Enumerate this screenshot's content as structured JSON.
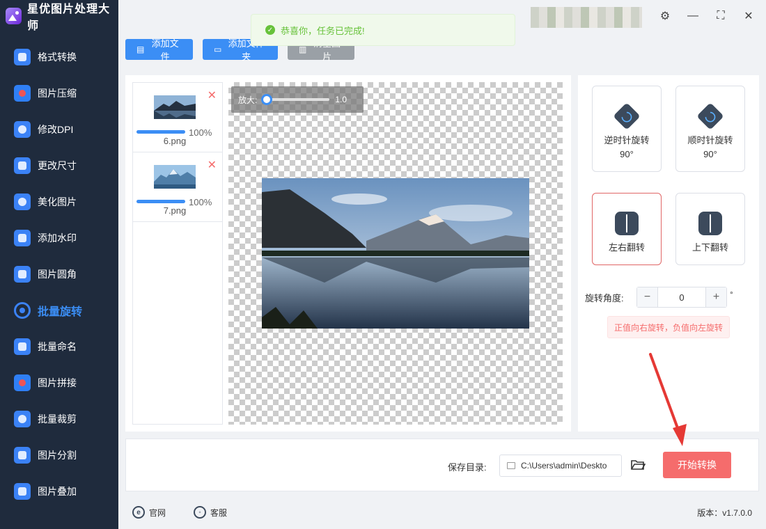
{
  "app": {
    "title": "星优图片处理大师"
  },
  "sidebar": {
    "items": [
      {
        "label": "格式转换",
        "icon": "image-convert-icon"
      },
      {
        "label": "图片压缩",
        "icon": "image-compress-icon"
      },
      {
        "label": "修改DPI",
        "icon": "dpi-icon"
      },
      {
        "label": "更改尺寸",
        "icon": "resize-icon"
      },
      {
        "label": "美化图片",
        "icon": "beautify-icon"
      },
      {
        "label": "添加水印",
        "icon": "watermark-icon"
      },
      {
        "label": "图片圆角",
        "icon": "rounded-corner-icon"
      },
      {
        "label": "批量旋转",
        "icon": "rotate-icon",
        "active": true
      },
      {
        "label": "批量命名",
        "icon": "rename-icon"
      },
      {
        "label": "图片拼接",
        "icon": "splice-icon"
      },
      {
        "label": "批量裁剪",
        "icon": "crop-icon"
      },
      {
        "label": "图片分割",
        "icon": "split-icon"
      },
      {
        "label": "图片叠加",
        "icon": "overlay-icon"
      }
    ]
  },
  "toolbar": {
    "add_file": "添加文件",
    "add_folder": "添加文件夹",
    "clear": "清空图片"
  },
  "toast": {
    "message": "恭喜你，任务已完成!"
  },
  "files": [
    {
      "name": "6.png",
      "progress": "100%",
      "progress_value": 1.0
    },
    {
      "name": "7.png",
      "progress": "100%",
      "progress_value": 1.0
    }
  ],
  "zoom": {
    "label": "放大:",
    "value": "1.0"
  },
  "rotate": {
    "ccw": "逆时针旋转90°",
    "cw": "顺时针旋转90°",
    "flip_h": "左右翻转",
    "flip_v": "上下翻转",
    "angle_label": "旋转角度:",
    "angle_value": "0",
    "degree_symbol": "°",
    "hint": "正值向右旋转，负值向左旋转"
  },
  "bottom": {
    "save_label": "保存目录:",
    "save_path": "C:\\Users\\admin\\Deskto",
    "start": "开始转换"
  },
  "footer": {
    "website": "官网",
    "service": "客服",
    "version": "版本：v1.7.0.0"
  },
  "colors": {
    "accent": "#3b8ef5",
    "sidebar_bg": "#1f2b3d",
    "danger": "#f56c6c",
    "success": "#67c23a"
  }
}
